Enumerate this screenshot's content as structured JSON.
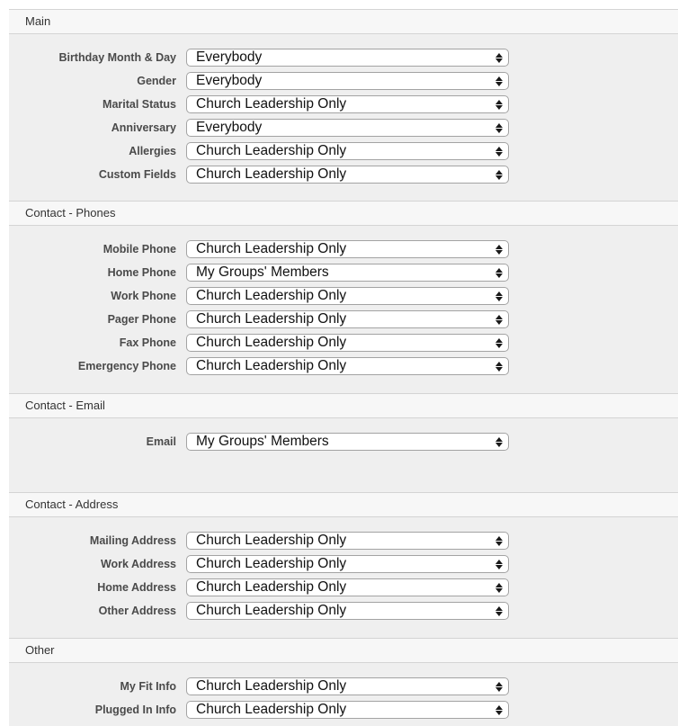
{
  "sections": [
    {
      "title": "Main",
      "rows": [
        {
          "label": "Birthday Month & Day",
          "value": "Everybody"
        },
        {
          "label": "Gender",
          "value": "Everybody"
        },
        {
          "label": "Marital Status",
          "value": "Church Leadership Only"
        },
        {
          "label": "Anniversary",
          "value": "Everybody"
        },
        {
          "label": "Allergies",
          "value": "Church Leadership Only"
        },
        {
          "label": "Custom Fields",
          "value": "Church Leadership Only"
        }
      ]
    },
    {
      "title": "Contact - Phones",
      "rows": [
        {
          "label": "Mobile Phone",
          "value": "Church Leadership Only"
        },
        {
          "label": "Home Phone",
          "value": "My Groups' Members"
        },
        {
          "label": "Work Phone",
          "value": "Church Leadership Only"
        },
        {
          "label": "Pager Phone",
          "value": "Church Leadership Only"
        },
        {
          "label": "Fax Phone",
          "value": "Church Leadership Only"
        },
        {
          "label": "Emergency Phone",
          "value": "Church Leadership Only"
        }
      ]
    },
    {
      "title": "Contact - Email",
      "rows": [
        {
          "label": "Email",
          "value": "My Groups' Members"
        }
      ]
    },
    {
      "title": "Contact - Address",
      "rows": [
        {
          "label": "Mailing Address",
          "value": "Church Leadership Only"
        },
        {
          "label": "Work Address",
          "value": "Church Leadership Only"
        },
        {
          "label": "Home Address",
          "value": "Church Leadership Only"
        },
        {
          "label": "Other Address",
          "value": "Church Leadership Only"
        }
      ]
    },
    {
      "title": "Other",
      "rows": [
        {
          "label": "My Fit Info",
          "value": "Church Leadership Only"
        },
        {
          "label": "Plugged In Info",
          "value": "Church Leadership Only"
        }
      ]
    }
  ]
}
